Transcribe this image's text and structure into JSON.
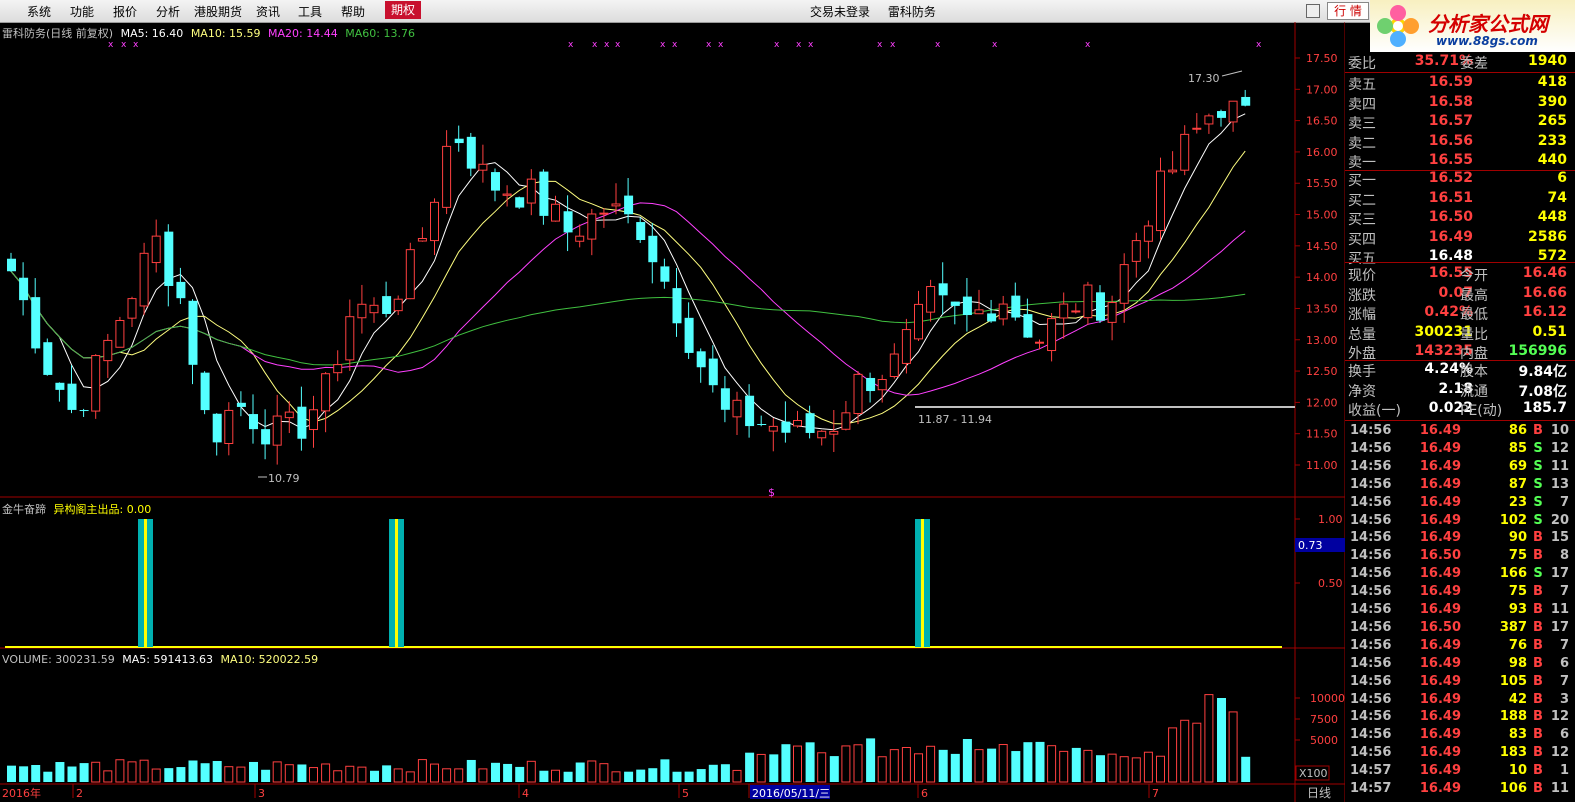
{
  "menu": {
    "items": [
      "系统",
      "功能",
      "报价",
      "分析",
      "港股期货",
      "资讯",
      "工具",
      "帮助",
      "期权"
    ],
    "active": "期权",
    "login_status": "交易未登录",
    "stock_name": "雷科防务",
    "trade_button": "行 情"
  },
  "logo": {
    "title": "分析家公式网",
    "url": "www.88gs.com"
  },
  "main_chart": {
    "title": "雷科防务(日线 前复权)",
    "ma5": "MA5: 16.40",
    "ma10": "MA10: 15.59",
    "ma20": "MA20: 14.44",
    "ma60": "MA60: 13.76",
    "price_ticks": [
      "17.50",
      "17.00",
      "16.50",
      "16.00",
      "15.50",
      "15.00",
      "14.50",
      "14.00",
      "13.50",
      "13.00",
      "12.50",
      "12.00",
      "11.50",
      "11.00"
    ],
    "annotation_high": "17.30",
    "annotation_low": "10.79",
    "annotation_range": "11.87 - 11.94",
    "marker": "$"
  },
  "indicator": {
    "name": "金牛奋蹄",
    "label": "异构阁主出品: 0.00",
    "ticks": [
      "1.00",
      "0.50"
    ],
    "current": "0.73"
  },
  "volume": {
    "label": "VOLUME: 300231.59",
    "ma5": "MA5: 591413.63",
    "ma10": "MA10: 520022.59",
    "ticks": [
      "10000",
      "7500",
      "5000"
    ],
    "unit": "X100"
  },
  "dates": {
    "axis": [
      "2016年",
      "2",
      "3",
      "4",
      "5",
      "2016/05/11/三",
      "6",
      "7"
    ],
    "period": "日线"
  },
  "quote": {
    "ratio_label": "委比",
    "ratio_value": "35.71%",
    "diff_label": "委差",
    "diff_value": "1940",
    "asks": [
      {
        "label": "卖五",
        "price": "16.59",
        "vol": "418"
      },
      {
        "label": "卖四",
        "price": "16.58",
        "vol": "390"
      },
      {
        "label": "卖三",
        "price": "16.57",
        "vol": "265"
      },
      {
        "label": "卖二",
        "price": "16.56",
        "vol": "233"
      },
      {
        "label": "卖一",
        "price": "16.55",
        "vol": "440"
      }
    ],
    "bids": [
      {
        "label": "买一",
        "price": "16.52",
        "vol": "6"
      },
      {
        "label": "买二",
        "price": "16.51",
        "vol": "74"
      },
      {
        "label": "买三",
        "price": "16.50",
        "vol": "448"
      },
      {
        "label": "买四",
        "price": "16.49",
        "vol": "2586"
      },
      {
        "label": "买五",
        "price": "16.48",
        "vol": "572"
      }
    ],
    "stats": [
      {
        "l1": "现价",
        "v1": "16.55",
        "l2": "今开",
        "v2": "16.46"
      },
      {
        "l1": "涨跌",
        "v1": "0.07",
        "l2": "最高",
        "v2": "16.66"
      },
      {
        "l1": "涨幅",
        "v1": "0.42%",
        "l2": "最低",
        "v2": "16.12"
      },
      {
        "l1": "总量",
        "v1": "300231",
        "l2": "量比",
        "v2": "0.51"
      },
      {
        "l1": "外盘",
        "v1": "143235",
        "l2": "内盘",
        "v2": "156996"
      }
    ],
    "fin": [
      {
        "l1": "换手",
        "v1": "4.24%",
        "l2": "股本",
        "v2": "9.84亿"
      },
      {
        "l1": "净资",
        "v1": "2.18",
        "l2": "流通",
        "v2": "7.08亿"
      },
      {
        "l1": "收益(一)",
        "v1": "0.022",
        "l2": "PE(动)",
        "v2": "185.7"
      }
    ],
    "ticks": [
      {
        "t": "14:56",
        "p": "16.49",
        "v": "86",
        "s": "B",
        "n": "10"
      },
      {
        "t": "14:56",
        "p": "16.49",
        "v": "85",
        "s": "S",
        "n": "12"
      },
      {
        "t": "14:56",
        "p": "16.49",
        "v": "69",
        "s": "S",
        "n": "11"
      },
      {
        "t": "14:56",
        "p": "16.49",
        "v": "87",
        "s": "S",
        "n": "13"
      },
      {
        "t": "14:56",
        "p": "16.49",
        "v": "23",
        "s": "S",
        "n": "7"
      },
      {
        "t": "14:56",
        "p": "16.49",
        "v": "102",
        "s": "S",
        "n": "20"
      },
      {
        "t": "14:56",
        "p": "16.49",
        "v": "90",
        "s": "B",
        "n": "15"
      },
      {
        "t": "14:56",
        "p": "16.50",
        "v": "75",
        "s": "B",
        "n": "8"
      },
      {
        "t": "14:56",
        "p": "16.49",
        "v": "166",
        "s": "S",
        "n": "17"
      },
      {
        "t": "14:56",
        "p": "16.49",
        "v": "75",
        "s": "B",
        "n": "7"
      },
      {
        "t": "14:56",
        "p": "16.49",
        "v": "93",
        "s": "B",
        "n": "11"
      },
      {
        "t": "14:56",
        "p": "16.50",
        "v": "387",
        "s": "B",
        "n": "17"
      },
      {
        "t": "14:56",
        "p": "16.49",
        "v": "76",
        "s": "B",
        "n": "7"
      },
      {
        "t": "14:56",
        "p": "16.49",
        "v": "98",
        "s": "B",
        "n": "6"
      },
      {
        "t": "14:56",
        "p": "16.49",
        "v": "105",
        "s": "B",
        "n": "7"
      },
      {
        "t": "14:56",
        "p": "16.49",
        "v": "42",
        "s": "B",
        "n": "3"
      },
      {
        "t": "14:56",
        "p": "16.49",
        "v": "188",
        "s": "B",
        "n": "12"
      },
      {
        "t": "14:56",
        "p": "16.49",
        "v": "83",
        "s": "B",
        "n": "6"
      },
      {
        "t": "14:56",
        "p": "16.49",
        "v": "183",
        "s": "B",
        "n": "12"
      },
      {
        "t": "14:57",
        "p": "16.49",
        "v": "10",
        "s": "B",
        "n": "1"
      },
      {
        "t": "14:57",
        "p": "16.49",
        "v": "106",
        "s": "B",
        "n": "11"
      }
    ]
  },
  "colors": {
    "up": "#ff4040",
    "down": "#54ffff",
    "ma5": "#ffffff",
    "ma10": "#ffff80",
    "ma20": "#ff40ff",
    "ma60": "#40c040"
  }
}
